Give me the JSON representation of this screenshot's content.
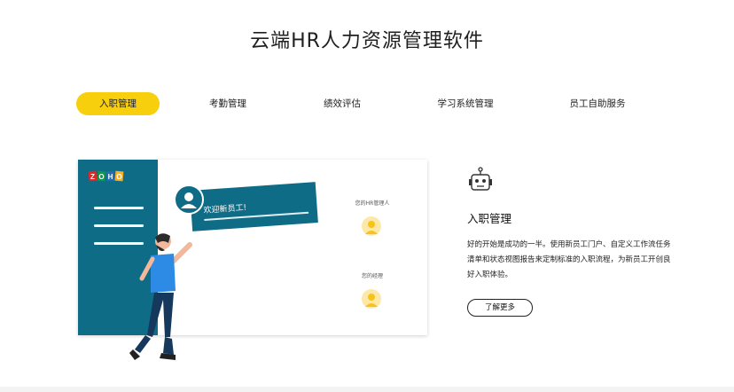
{
  "page": {
    "title": "云端HR人力资源管理软件"
  },
  "tabs": [
    {
      "label": "入职管理",
      "active": true
    },
    {
      "label": "考勤管理",
      "active": false
    },
    {
      "label": "绩效评估",
      "active": false
    },
    {
      "label": "学习系统管理",
      "active": false
    },
    {
      "label": "员工自助服务",
      "active": false
    }
  ],
  "illustration": {
    "brand_logo": "ZOHO",
    "welcome_text": "欢迎新员工!",
    "hr_manager_label": "您的HR管理人",
    "manager_label": "您的经理"
  },
  "content": {
    "icon": "robot-icon",
    "heading": "入职管理",
    "description": "好的开始是成功的一半。使用新员工门户、自定义工作流任务清单和状态视图报告来定制标准的入职流程，为新员工开创良好入职体验。",
    "more_button": "了解更多"
  },
  "colors": {
    "accent_yellow": "#f7cf0c",
    "teal": "#0f6c86"
  }
}
